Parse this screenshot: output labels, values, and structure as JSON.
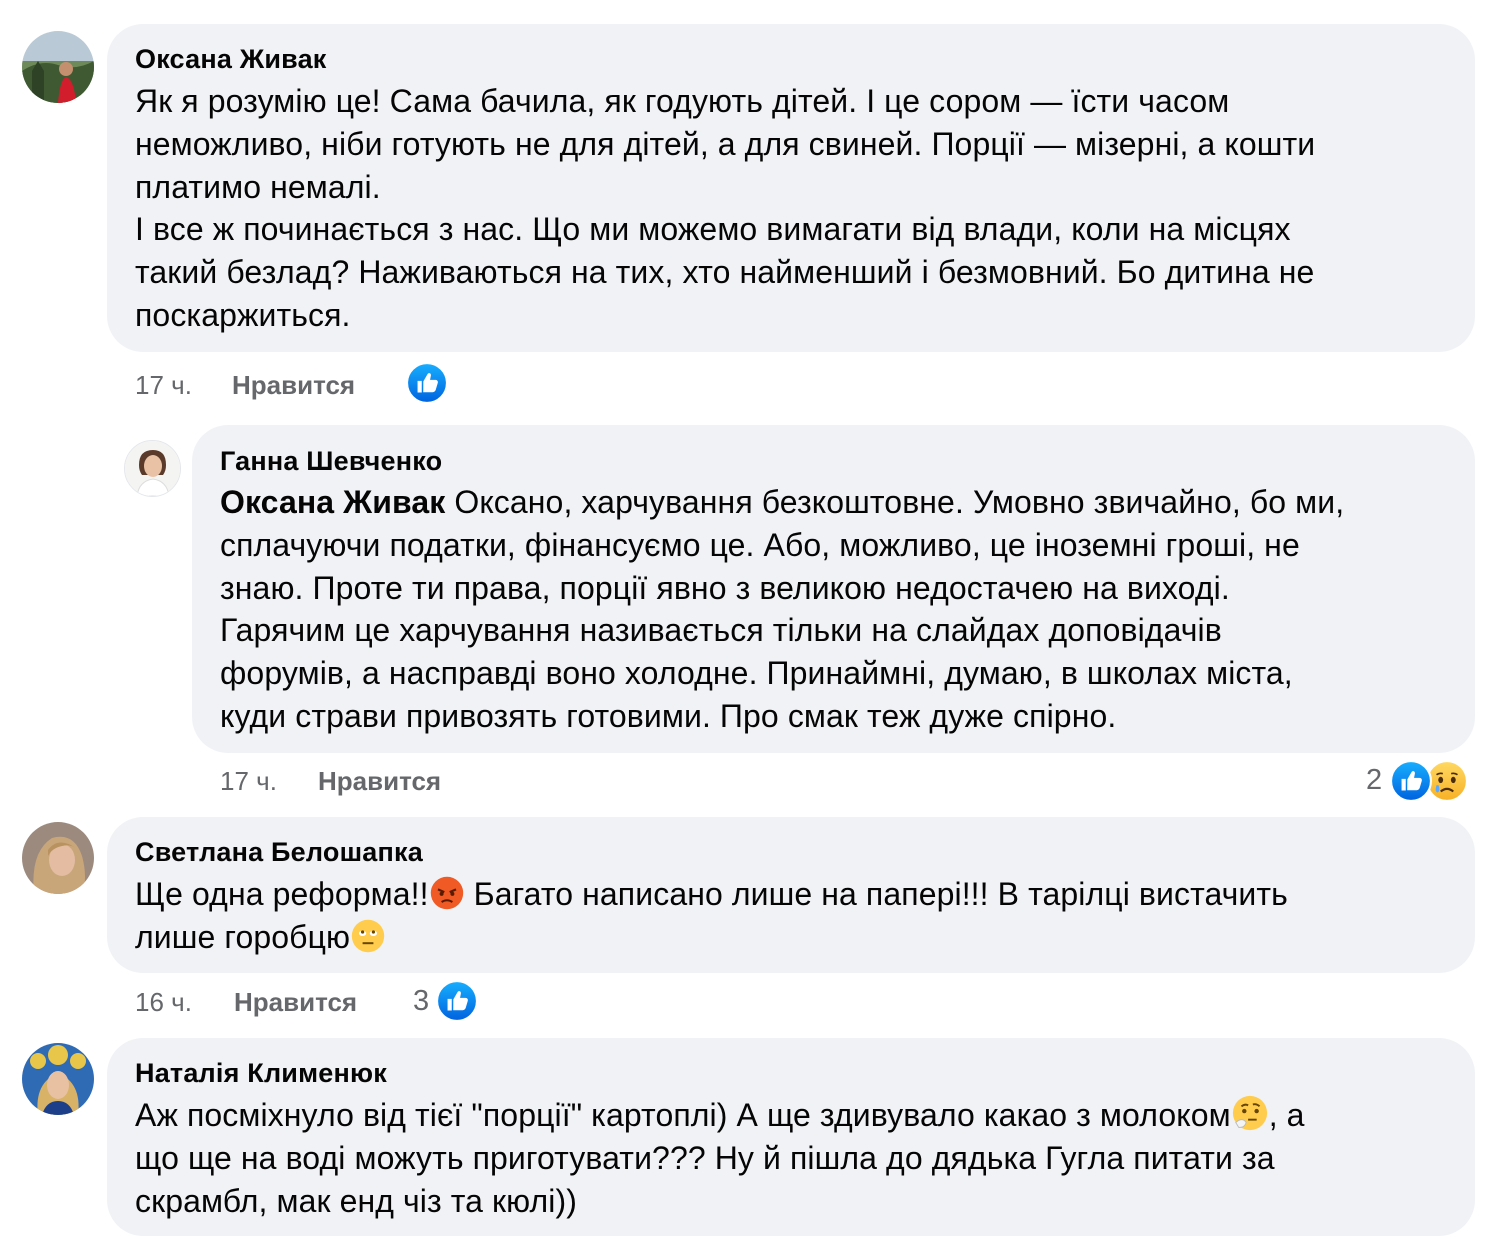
{
  "comments": [
    {
      "author": "Оксана Живак",
      "lines": [
        "Як я розумію це! Сама бачила, як годують дітей. І це сором — їсти часом",
        "неможливо, ніби готують не для дітей, а для свиней. Порції — мізерні, а кошти",
        "платимо немалі.",
        "І все ж починається з нас. Що ми можемо вимагати від влади, коли на місцях",
        "такий безлад? Наживаються на тих, хто найменший і безмовний. Бо дитина не",
        "поскаржиться."
      ],
      "time": "17 ч.",
      "like_label": "Нравится",
      "reactions": [
        "like-icon"
      ]
    },
    {
      "author": "Ганна Шевченко",
      "mention": "Оксана Живак",
      "lines": [
        " Оксано, харчування безкоштовне. Умовно звичайно, бо ми,",
        "сплачуючи податки, фінансуємо це. Або, можливо, це іноземні гроші, не",
        "знаю. Проте ти права, порції явно з великою недостачею на виході.",
        "Гарячим це харчування називається тільки на слайдах доповідачів",
        "форумів, а насправді воно холодне. Принаймні, думаю, в школах міста,",
        "куди страви привозять готовими. Про смак теж дуже спірно."
      ],
      "time": "17 ч.",
      "like_label": "Нравится",
      "reaction_count": "2",
      "reactions": [
        "like-icon",
        "sad-icon"
      ]
    },
    {
      "author": "Светлана Белошапка",
      "line1_a": "Ще одна реформа!!",
      "line1_b": " Багато написано лише на папері!!! В тарілці вистачить",
      "line2_a": "лише горобцю",
      "time": "16 ч.",
      "like_label": "Нравится",
      "reaction_count": "3",
      "reactions": [
        "like-icon"
      ]
    },
    {
      "author": "Наталія Клименюк",
      "line1_a": "Аж посміхнуло від тієї \"порції\" картоплі) А ще здивувало какао з молоком",
      "line1_b": ", а",
      "line2": "що ще на воді можуть приготувати??? Ну й пішла до дядька Гугла питати за",
      "line3": "скрамбл, мак енд чіз та кюлі))"
    }
  ],
  "colors": {
    "bubble": "#f0f2f5",
    "like_blue": "#1877f2",
    "meta_gray": "#65676b"
  }
}
